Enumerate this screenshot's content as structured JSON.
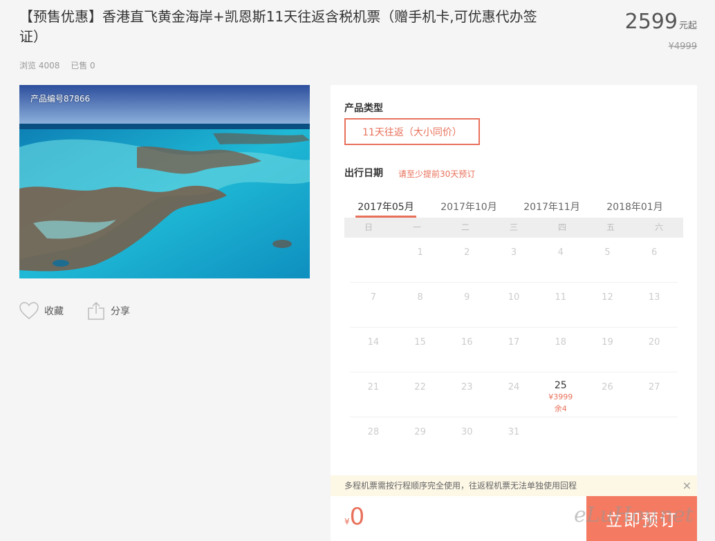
{
  "product": {
    "title": "【预售优惠】香港直飞黄金海岸+凯恩斯11天往返含税机票（赠手机卡,可优惠代办签证）",
    "price": "2599",
    "price_unit": "元起",
    "original_price": "¥4999",
    "views": "浏览 4008",
    "sold": "已售 0",
    "code": "产品编号87866"
  },
  "actions": {
    "favorite": "收藏",
    "share": "分享"
  },
  "booking": {
    "type_title": "产品类型",
    "type_option": "11天往返（大小同价）",
    "date_title": "出行日期",
    "date_note": "请至少提前30天预订",
    "months": [
      "2017年05月",
      "2017年10月",
      "2017年11月",
      "2018年01月"
    ],
    "weekdays": [
      "日",
      "一",
      "二",
      "三",
      "四",
      "五",
      "六"
    ],
    "calendar": [
      [
        "",
        "1",
        "2",
        "3",
        "4",
        "5",
        "6"
      ],
      [
        "7",
        "8",
        "9",
        "10",
        "11",
        "12",
        "13"
      ],
      [
        "14",
        "15",
        "16",
        "17",
        "18",
        "19",
        "20"
      ],
      [
        "21",
        "22",
        "23",
        "24",
        "25",
        "26",
        "27"
      ],
      [
        "28",
        "29",
        "30",
        "31",
        "",
        "",
        ""
      ]
    ],
    "available": {
      "day": "25",
      "price": "¥3999",
      "stock": "余4"
    },
    "notice": "多程机票需按行程顺序完全使用，往返程机票无法单独使用回程",
    "close_icon": "×",
    "currency": "¥",
    "total": "0",
    "book_label": "立即预订"
  },
  "watermark": "eLuHoy.net",
  "colors": {
    "accent": "#e8705a",
    "button": "#f47b62"
  }
}
